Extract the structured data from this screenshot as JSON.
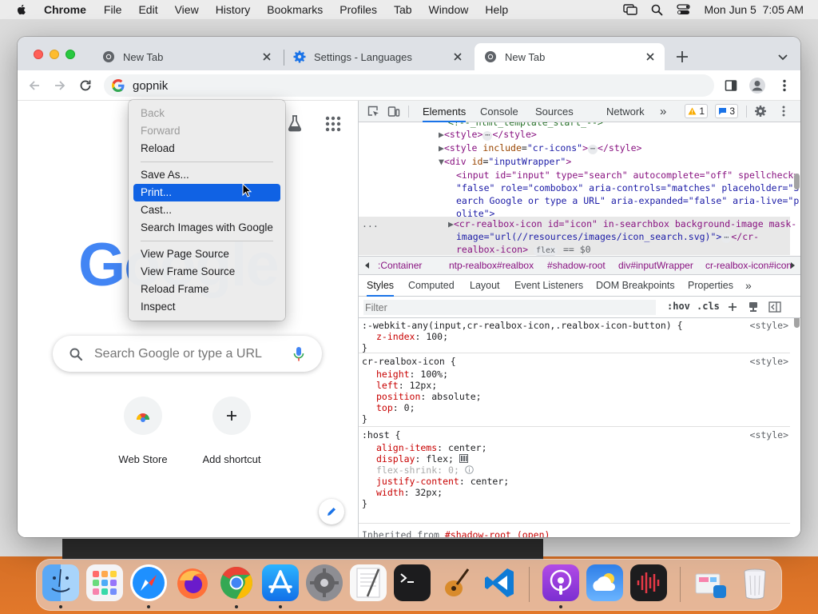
{
  "menubar": {
    "app_name": "Chrome",
    "items": [
      "File",
      "Edit",
      "View",
      "History",
      "Bookmarks",
      "Profiles",
      "Tab",
      "Window",
      "Help"
    ],
    "clock": "Mon Jun 5  7:05 AM"
  },
  "tabs": [
    {
      "title": "New Tab",
      "active": false
    },
    {
      "title": "Settings - Languages",
      "active": false
    },
    {
      "title": "New Tab",
      "active": true
    }
  ],
  "omnibox": {
    "value": "gopnik"
  },
  "context_menu": {
    "items": [
      {
        "label": "Back",
        "disabled": true
      },
      {
        "label": "Forward",
        "disabled": true
      },
      {
        "label": "Reload",
        "disabled": false
      },
      {
        "label": "Save As...",
        "disabled": false
      },
      {
        "label": "Print...",
        "disabled": false,
        "highlighted": true
      },
      {
        "label": "Cast...",
        "disabled": false
      },
      {
        "label": "Search Images with Google",
        "disabled": false
      },
      {
        "label": "View Page Source",
        "disabled": false
      },
      {
        "label": "View Frame Source",
        "disabled": false
      },
      {
        "label": "Reload Frame",
        "disabled": false
      },
      {
        "label": "Inspect",
        "disabled": false
      }
    ]
  },
  "ntp": {
    "logo_text": "Google",
    "search_placeholder": "Search Google or type a URL",
    "shortcuts": [
      {
        "label": "Web Store"
      },
      {
        "label": "Add shortcut"
      }
    ]
  },
  "devtools": {
    "tabs": [
      "Elements",
      "Console",
      "Sources",
      "Network"
    ],
    "more": "»",
    "warnings": "1",
    "messages": "3",
    "tree": {
      "line0": "<!--_html_template_start_-->",
      "line1_tag_open": "<style>",
      "line1_tag_close": "</style>",
      "line2_tag": "<style",
      "line2_attr": "include",
      "line2_val": "\"cr-icons\"",
      "line2_close": "</style>",
      "line3_tag": "<div",
      "line3_attr": "id",
      "line3_val": "\"inputWrapper\"",
      "line4": "<input id=\"input\" type=\"search\" autocomplete=\"off\" spellcheck=",
      "line5": "\"false\" role=\"combobox\" aria-controls=\"matches\" placeholder=\"S",
      "line6": "earch Google or type a URL\" aria-expanded=\"false\" aria-live=\"p",
      "line7": "olite\">",
      "line8": "<cr-realbox-icon id=\"icon\" in-searchbox background-image mask-",
      "line9": "image=\"url(//resources/images/icon_search.svg)\">",
      "line9_close": "</cr-",
      "line10": "realbox-icon>",
      "line10_badge": "flex",
      "line10_eq": "== $0",
      "dots": "..."
    },
    "breadcrumbs": [
      ":Container",
      "ntp-realbox#realbox",
      "#shadow-root",
      "div#inputWrapper",
      "cr-realbox-icon#icon"
    ],
    "styles_tabs": [
      "Styles",
      "Computed",
      "Layout",
      "Event Listeners",
      "DOM Breakpoints",
      "Properties"
    ],
    "filter_placeholder": "Filter",
    "hov": ":hov",
    "cls": ".cls",
    "rules": [
      {
        "selector": ":-webkit-any(input,cr-realbox-icon,.realbox-icon-button) {",
        "source": "<style>",
        "props": [
          {
            "name": "z-index",
            "value": "100;"
          }
        ]
      },
      {
        "selector": "cr-realbox-icon {",
        "source": "<style>",
        "props": [
          {
            "name": "height",
            "value": "100%;"
          },
          {
            "name": "left",
            "value": "12px;"
          },
          {
            "name": "position",
            "value": "absolute;"
          },
          {
            "name": "top",
            "value": "0;"
          }
        ]
      },
      {
        "selector": ":host {",
        "source": "<style>",
        "props": [
          {
            "name": "align-items",
            "value": "center;"
          },
          {
            "name": "display",
            "value": "flex;"
          },
          {
            "name": "flex-shrink",
            "value": "0;"
          },
          {
            "name": "justify-content",
            "value": "center;"
          },
          {
            "name": "width",
            "value": "32px;"
          }
        ]
      }
    ],
    "inherited_label": "Inherited from",
    "inherited_link": "#shadow-root (open)"
  },
  "colors": {
    "accent": "#1a73e8",
    "menu_highlight": "#1062e4",
    "tag": "#881280",
    "attr": "#994500",
    "value": "#1a1aa6",
    "css_prop": "#c80000"
  },
  "dock": {
    "apps": [
      "finder-icon",
      "launchpad-icon",
      "safari-icon",
      "firefox-icon",
      "chrome-icon",
      "app-store-icon",
      "system-settings-icon",
      "textedit-icon",
      "terminal-icon",
      "garageband-icon",
      "vscode-icon",
      "podcasts-icon",
      "weather-icon",
      "audio-app-icon",
      "downloads-stack-icon",
      "trash-icon"
    ]
  }
}
